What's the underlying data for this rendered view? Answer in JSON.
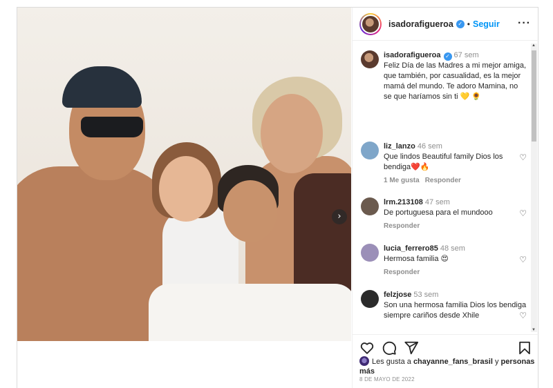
{
  "post": {
    "next_icon": "chevron-right-icon"
  },
  "header": {
    "username": "isadorafigueroa",
    "verified_icon": "verified-badge-icon",
    "separator": "•",
    "follow_label": "Seguir",
    "more_icon": "more-options-icon"
  },
  "caption": {
    "username": "isadorafigueroa",
    "time": "67 sem",
    "text": "Feliz Día de las Madres a mi mejor amiga, que también, por casualidad, es la mejor mamá del mundo. Te adoro Mamina, no se que haríamos sin ti 💛 🌻"
  },
  "comments": [
    {
      "username": "liz_lanzo",
      "time": "46 sem",
      "text": "Que lindos Beautiful family Dios los bendiga❤️🔥",
      "likes": "1 Me gusta",
      "reply": "Responder",
      "avatar_color": "#7fa6c9"
    },
    {
      "username": "lrm.213108",
      "time": "47 sem",
      "text": "De portuguesa para el mundooo",
      "likes": "",
      "reply": "Responder",
      "avatar_color": "#6b5a4e"
    },
    {
      "username": "lucia_ferrero85",
      "time": "48 sem",
      "text": "Hermosa familia 😍",
      "likes": "",
      "reply": "Responder",
      "avatar_color": "#9b8fb8"
    },
    {
      "username": "felzjose",
      "time": "53 sem",
      "text": "Son una hermosa familia Dios los bendiga siempre cariños desde Xhile",
      "likes": "",
      "reply": "",
      "avatar_color": "#2b2b2b"
    }
  ],
  "actions": {
    "like_icon": "heart-icon",
    "comment_icon": "comment-icon",
    "share_icon": "share-icon",
    "save_icon": "bookmark-icon"
  },
  "likes": {
    "prefix": "Les gusta a",
    "user": "chayanne_fans_brasil",
    "connector": "y",
    "others": "personas más"
  },
  "date": "8 DE MAYO DE 2022"
}
